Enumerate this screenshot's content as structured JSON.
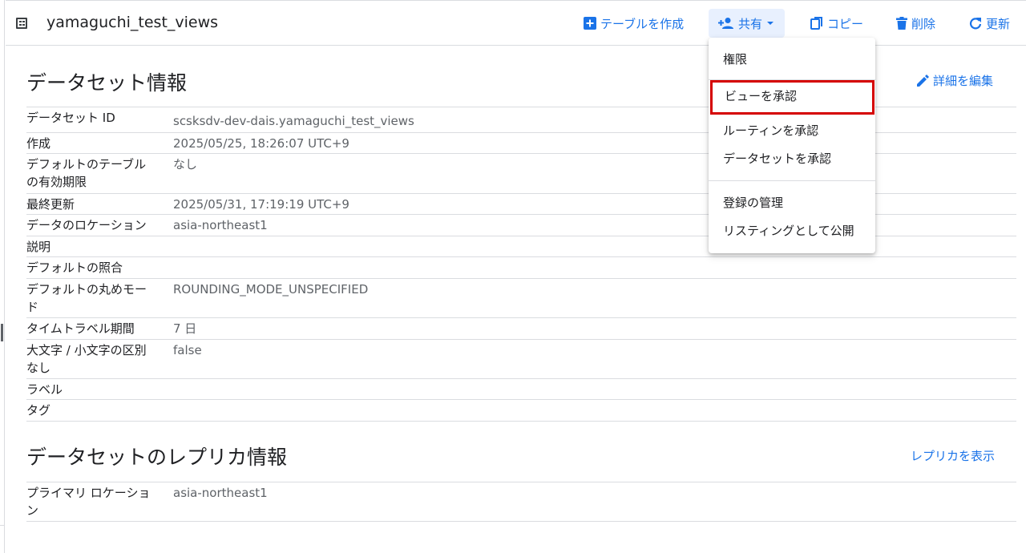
{
  "header": {
    "dataset_name": "yamaguchi_test_views",
    "actions": {
      "create_table": "テーブルを作成",
      "share": "共有",
      "copy": "コピー",
      "delete": "削除",
      "refresh": "更新"
    }
  },
  "info": {
    "title": "データセット情報",
    "edit_label": "詳細を編集",
    "rows": [
      {
        "key": "データセット ID",
        "value": "scsksdv-dev-dais.yamaguchi_test_views"
      },
      {
        "key": "作成",
        "value": "2025/05/25, 18:26:07 UTC+9"
      },
      {
        "key": "デフォルトのテーブルの有効期限",
        "value": "なし"
      },
      {
        "key": "最終更新",
        "value": "2025/05/31, 17:19:19 UTC+9"
      },
      {
        "key": "データのロケーション",
        "value": "asia-northeast1"
      },
      {
        "key": "説明",
        "value": ""
      },
      {
        "key": "デフォルトの照合",
        "value": ""
      },
      {
        "key": "デフォルトの丸めモード",
        "value": "ROUNDING_MODE_UNSPECIFIED"
      },
      {
        "key": "タイムトラベル期間",
        "value": "7 日"
      },
      {
        "key": "大文字 / 小文字の区別なし",
        "value": "false"
      },
      {
        "key": "ラベル",
        "value": ""
      },
      {
        "key": "タグ",
        "value": ""
      }
    ]
  },
  "replica": {
    "title": "データセットのレプリカ情報",
    "show_label": "レプリカを表示",
    "rows": [
      {
        "key": "プライマリ ロケーション",
        "value": "asia-northeast1"
      }
    ]
  },
  "share_menu": {
    "items": [
      "権限",
      "ビューを承認",
      "ルーティンを承認",
      "データセットを承認",
      "登録の管理",
      "リスティングとして公開"
    ]
  },
  "colors": {
    "accent": "#1a73e8",
    "highlight_border": "#d50000",
    "active_bg": "#e8f0fe"
  }
}
